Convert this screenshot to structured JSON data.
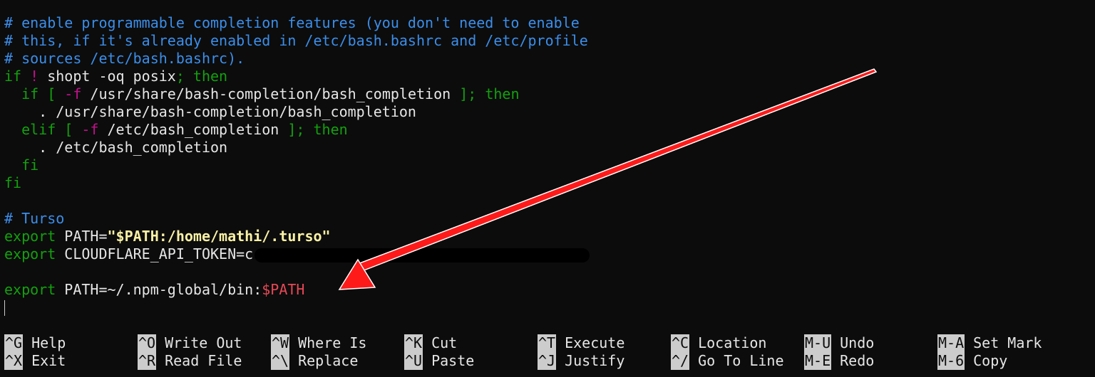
{
  "editor": {
    "lines": [
      [
        {
          "t": "# enable programmable completion features (you don't need to enable",
          "c": "cm"
        }
      ],
      [
        {
          "t": "# this, if it's already enabled in /etc/bash.bashrc and /etc/profile",
          "c": "cm"
        }
      ],
      [
        {
          "t": "# sources /etc/bash.bashrc).",
          "c": "cm"
        }
      ],
      [
        {
          "t": "if",
          "c": "kw"
        },
        {
          "t": " ! ",
          "c": "op"
        },
        {
          "t": "shopt -oq posix",
          "c": "tx"
        },
        {
          "t": "; then",
          "c": "kw"
        }
      ],
      [
        {
          "t": "  if [ ",
          "c": "kw"
        },
        {
          "t": "-f",
          "c": "op"
        },
        {
          "t": " /usr/share/bash-completion/bash_completion ",
          "c": "tx"
        },
        {
          "t": "]; then",
          "c": "kw"
        }
      ],
      [
        {
          "t": "    . /usr/share/bash-completion/bash_completion",
          "c": "tx"
        }
      ],
      [
        {
          "t": "  elif [ ",
          "c": "kw"
        },
        {
          "t": "-f",
          "c": "op"
        },
        {
          "t": " /etc/bash_completion ",
          "c": "tx"
        },
        {
          "t": "]; then",
          "c": "kw"
        }
      ],
      [
        {
          "t": "    . /etc/bash_completion",
          "c": "tx"
        }
      ],
      [
        {
          "t": "  fi",
          "c": "kw"
        }
      ],
      [
        {
          "t": "fi",
          "c": "kw"
        }
      ],
      [
        {
          "t": "",
          "c": "tx"
        }
      ],
      [
        {
          "t": "# Turso",
          "c": "cm"
        }
      ],
      [
        {
          "t": "export",
          "c": "kw"
        },
        {
          "t": " PATH=",
          "c": "tx"
        },
        {
          "t": "\"$PATH:/home/mathi/.turso\"",
          "c": "str"
        }
      ],
      [
        {
          "t": "export",
          "c": "kw"
        },
        {
          "t": " CLOUDFLARE_API_TOKEN=c",
          "c": "tx"
        },
        {
          "t": "",
          "c": "redact"
        }
      ],
      [
        {
          "t": "",
          "c": "tx"
        }
      ],
      [
        {
          "t": "export",
          "c": "kw"
        },
        {
          "t": " PATH=~/.npm-global/bin:",
          "c": "tx"
        },
        {
          "t": "$PATH",
          "c": "var"
        }
      ]
    ]
  },
  "shortcuts": {
    "row1": [
      {
        "key": "^G",
        "label": "Help"
      },
      {
        "key": "^O",
        "label": "Write Out"
      },
      {
        "key": "^W",
        "label": "Where Is"
      },
      {
        "key": "^K",
        "label": "Cut"
      },
      {
        "key": "^T",
        "label": "Execute"
      },
      {
        "key": "^C",
        "label": "Location"
      },
      {
        "key": "M-U",
        "label": "Undo"
      },
      {
        "key": "M-A",
        "label": "Set Mark"
      }
    ],
    "row2": [
      {
        "key": "^X",
        "label": "Exit"
      },
      {
        "key": "^R",
        "label": "Read File"
      },
      {
        "key": "^\\",
        "label": "Replace"
      },
      {
        "key": "^U",
        "label": "Paste"
      },
      {
        "key": "^J",
        "label": "Justify"
      },
      {
        "key": "^/",
        "label": "Go To Line"
      },
      {
        "key": "M-E",
        "label": "Redo"
      },
      {
        "key": "M-6",
        "label": "Copy"
      }
    ]
  },
  "annotation": {
    "color": "#ff1a1a"
  }
}
